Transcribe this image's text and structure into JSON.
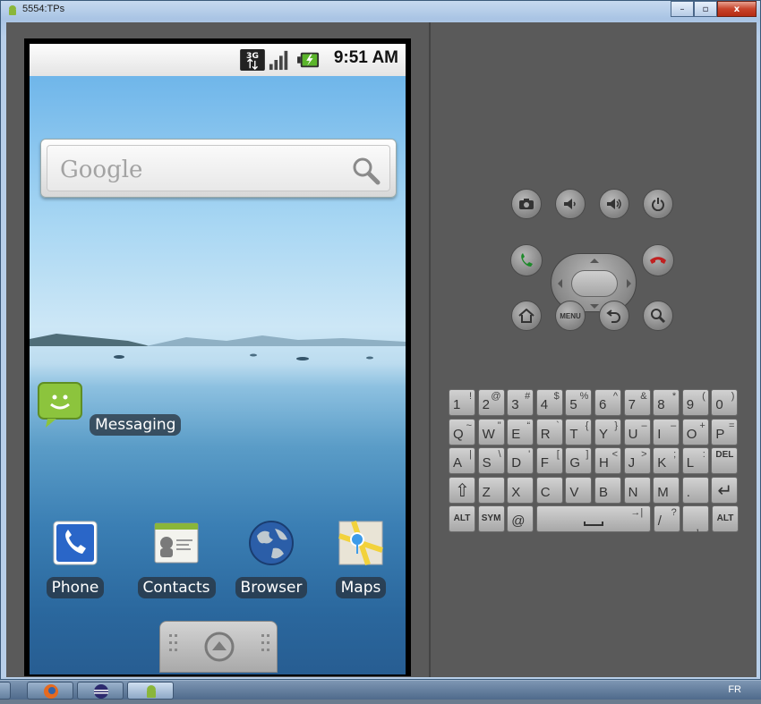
{
  "window": {
    "title": "5554:TPs"
  },
  "window_buttons": {
    "minimize": "–",
    "maximize": "▫",
    "close": "x"
  },
  "status_bar": {
    "network": "3G",
    "time": "9:51 AM"
  },
  "search_widget": {
    "logo_text": "Google"
  },
  "apps": [
    {
      "label": "Messaging"
    },
    {
      "label": "Phone"
    },
    {
      "label": "Contacts"
    },
    {
      "label": "Browser"
    },
    {
      "label": "Maps"
    }
  ],
  "controls": {
    "menu_label": "MENU"
  },
  "keyboard": {
    "rows": [
      [
        {
          "main": "1",
          "alt": "!"
        },
        {
          "main": "2",
          "alt": "@"
        },
        {
          "main": "3",
          "alt": "#"
        },
        {
          "main": "4",
          "alt": "$"
        },
        {
          "main": "5",
          "alt": "%"
        },
        {
          "main": "6",
          "alt": "^"
        },
        {
          "main": "7",
          "alt": "&"
        },
        {
          "main": "8",
          "alt": "*"
        },
        {
          "main": "9",
          "alt": "("
        },
        {
          "main": "0",
          "alt": ")"
        }
      ],
      [
        {
          "main": "Q",
          "alt": "~"
        },
        {
          "main": "W",
          "alt": "\""
        },
        {
          "main": "E",
          "alt": "“"
        },
        {
          "main": "R",
          "alt": "`"
        },
        {
          "main": "T",
          "alt": "{"
        },
        {
          "main": "Y",
          "alt": "}"
        },
        {
          "main": "U",
          "alt": "–"
        },
        {
          "main": "I",
          "alt": "–"
        },
        {
          "main": "O",
          "alt": "+"
        },
        {
          "main": "P",
          "alt": "="
        }
      ],
      [
        {
          "main": "A",
          "alt": "|"
        },
        {
          "main": "S",
          "alt": "\\"
        },
        {
          "main": "D",
          "alt": "'"
        },
        {
          "main": "F",
          "alt": "["
        },
        {
          "main": "G",
          "alt": "]"
        },
        {
          "main": "H",
          "alt": "<"
        },
        {
          "main": "J",
          "alt": ">"
        },
        {
          "main": "K",
          "alt": ";"
        },
        {
          "main": "L",
          "alt": ":"
        },
        {
          "main": "DEL",
          "alt": ""
        }
      ],
      [
        {
          "main": "⇧",
          "alt": ""
        },
        {
          "main": "Z",
          "alt": ""
        },
        {
          "main": "X",
          "alt": ""
        },
        {
          "main": "C",
          "alt": ""
        },
        {
          "main": "V",
          "alt": ""
        },
        {
          "main": "B",
          "alt": ""
        },
        {
          "main": "N",
          "alt": ""
        },
        {
          "main": "M",
          "alt": ""
        },
        {
          "main": ".",
          "alt": ""
        },
        {
          "main": "↵",
          "alt": ""
        }
      ]
    ],
    "bottom_row": {
      "alt_left": "ALT",
      "sym": "SYM",
      "at": "@",
      "space_alt": "→|",
      "slash": "/",
      "slash_alt": "?",
      "comma": ",",
      "alt_right": "ALT"
    }
  },
  "taskbar": {
    "language": "FR"
  },
  "colors": {
    "frame": "#b8cfe9",
    "emulator_bg": "#5a5a5a",
    "close_red": "#c7432b"
  }
}
